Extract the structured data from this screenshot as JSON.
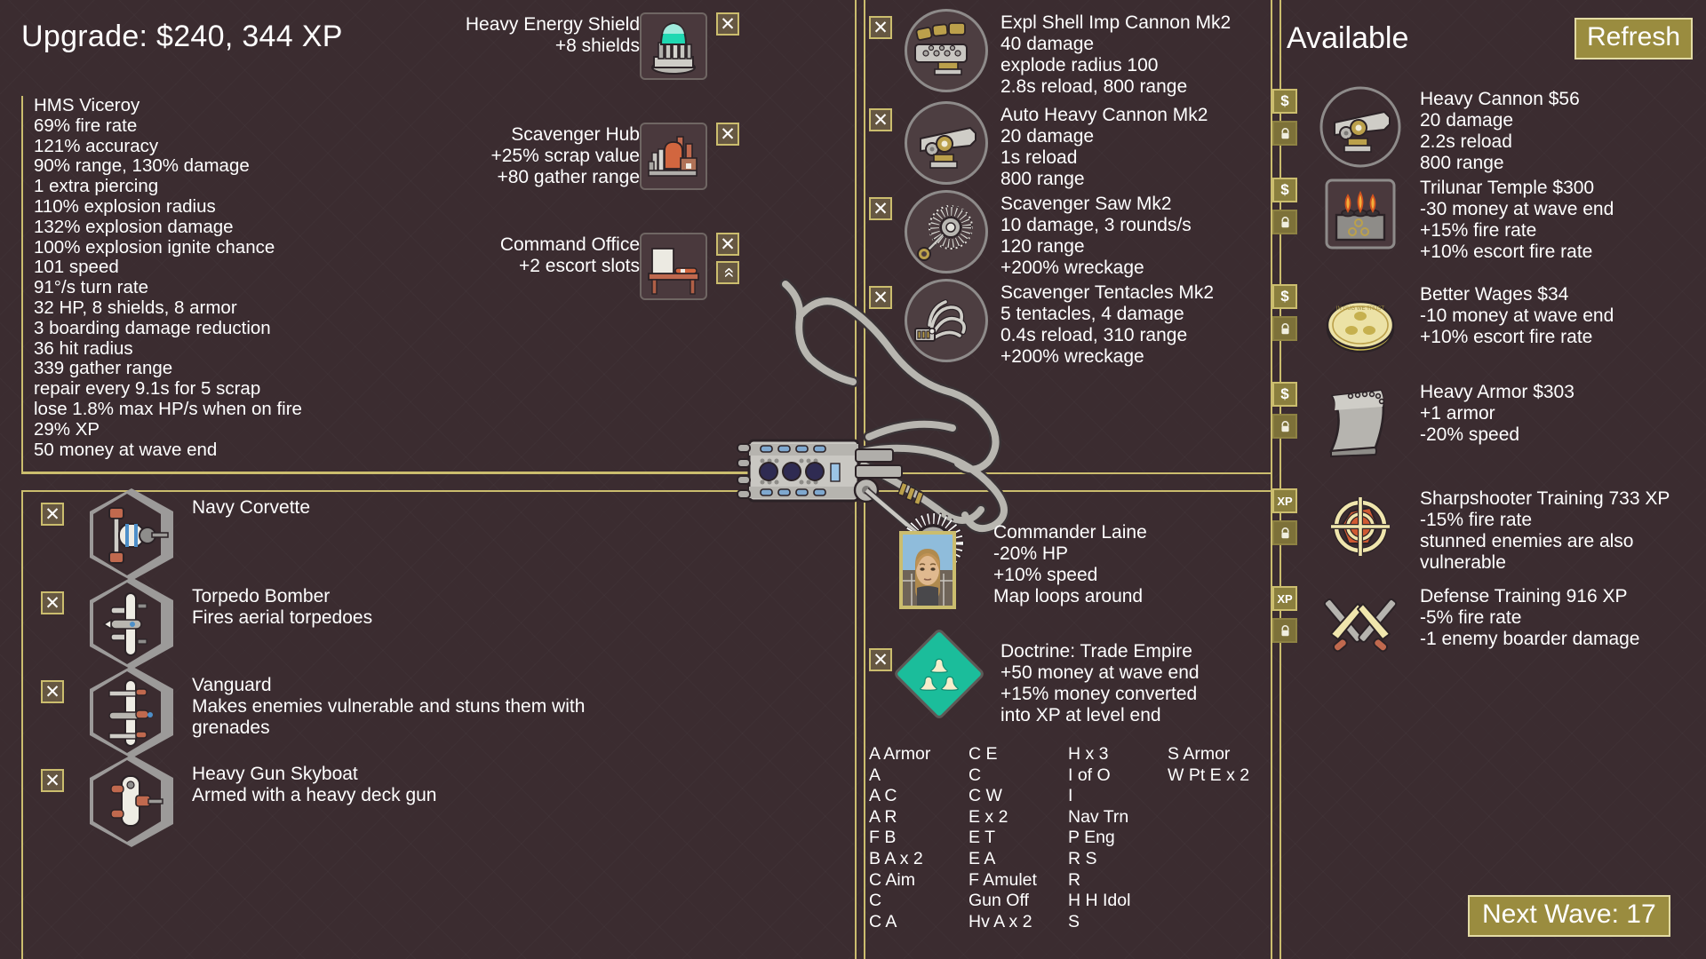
{
  "header": {
    "title": "Upgrade: $240, 344 XP"
  },
  "ship_stats": {
    "lines": [
      "HMS Viceroy",
      "69% fire rate",
      "121% accuracy",
      "90% range, 130% damage",
      "1 extra piercing",
      "110% explosion radius",
      "132% explosion damage",
      "100% explosion ignite chance",
      "101 speed",
      "91°/s turn rate",
      "32 HP, 8 shields, 8 armor",
      "3 boarding damage reduction",
      "36 hit radius",
      "339 gather range",
      "repair every 9.1s for 5 scrap",
      "lose 1.8% max HP/s when on fire",
      "29% XP",
      "50 money at wave end"
    ]
  },
  "escorts": [
    {
      "name": "Navy Corvette",
      "desc": "",
      "icon": "navy-corvette-icon",
      "remove_label": "✕"
    },
    {
      "name": "Torpedo Bomber",
      "desc": "Fires aerial torpedoes",
      "icon": "torpedo-bomber-icon",
      "remove_label": "✕"
    },
    {
      "name": "Vanguard",
      "desc": "Makes enemies vulnerable and stuns them with grenades",
      "icon": "vanguard-icon",
      "remove_label": "✕"
    },
    {
      "name": "Heavy Gun Skyboat",
      "desc": "Armed with a heavy deck gun",
      "icon": "heavy-gun-skyboat-icon",
      "remove_label": "✕"
    }
  ],
  "modules": [
    {
      "name": "Heavy Energy Shield",
      "effects": [
        "+8 shields"
      ],
      "icon": "energy-shield-icon",
      "remove_label": "✕",
      "has_upgrade": false
    },
    {
      "name": "Scavenger Hub",
      "effects": [
        "+25% scrap value",
        "+80 gather range"
      ],
      "icon": "scavenger-hub-icon",
      "remove_label": "✕",
      "has_upgrade": false
    },
    {
      "name": "Command Office",
      "effects": [
        "+2 escort slots"
      ],
      "icon": "command-office-icon",
      "remove_label": "✕",
      "upgrade_label": "»",
      "has_upgrade": true
    }
  ],
  "weapons": [
    {
      "name": "Expl Shell Imp Cannon Mk2",
      "stats": [
        "40 damage",
        "explode radius 100",
        "2.8s reload, 800 range"
      ],
      "icon": "explosive-shell-cannon-icon",
      "remove_label": "✕"
    },
    {
      "name": "Auto Heavy Cannon Mk2",
      "stats": [
        "20 damage",
        "1s reload",
        "800 range"
      ],
      "icon": "auto-heavy-cannon-icon",
      "remove_label": "✕"
    },
    {
      "name": "Scavenger Saw Mk2",
      "stats": [
        "10 damage, 3 rounds/s",
        "120 range",
        "+200% wreckage"
      ],
      "icon": "scavenger-saw-icon",
      "remove_label": "✕"
    },
    {
      "name": "Scavenger Tentacles Mk2",
      "stats": [
        "5 tentacles, 4 damage",
        "0.4s reload, 310 range",
        "+200% wreckage"
      ],
      "icon": "scavenger-tentacles-icon",
      "remove_label": "✕"
    }
  ],
  "commander": {
    "name": "Commander Laine",
    "effects": [
      "-20% HP",
      "+10% speed",
      "Map loops around"
    ],
    "portrait": "commander-portrait"
  },
  "doctrine": {
    "name": "Doctrine: Trade Empire",
    "effects": [
      "+50 money at wave end",
      "+15% money converted",
      "into XP at level end"
    ],
    "icon": "trade-empire-icon",
    "remove_label": "✕"
  },
  "abbreviations": {
    "columns": [
      [
        "A Armor",
        "A",
        "A C",
        "A R",
        "F B",
        "B A x 2",
        "C Aim",
        "C",
        "C A"
      ],
      [
        "C E",
        "C",
        "C W",
        "E x 2",
        "E T",
        "E A",
        "F Amulet",
        "Gun Off",
        "Hv A x 2"
      ],
      [
        "H x 3",
        "I of O",
        "I",
        "Nav Trn",
        "P Eng",
        "R S",
        "R",
        "H H Idol",
        "S"
      ],
      [
        "S Armor",
        "W Pt E x 2"
      ]
    ]
  },
  "available": {
    "title": "Available",
    "refresh_label": "Refresh",
    "money_badge": "$",
    "xp_badge": "XP",
    "lock_badge": "🔒",
    "items": [
      {
        "name": "Heavy Cannon $56",
        "effects": [
          "20 damage",
          "2.2s reload",
          "800 range"
        ],
        "icon": "heavy-cannon-icon",
        "cost_type": "$"
      },
      {
        "name": "Trilunar Temple $300",
        "effects": [
          "-30 money at wave end",
          "+15% fire rate",
          "+10% escort fire rate"
        ],
        "icon": "trilunar-temple-icon",
        "cost_type": "$"
      },
      {
        "name": "Better Wages $34",
        "effects": [
          "-10 money at wave end",
          "+10% escort fire rate"
        ],
        "icon": "better-wages-coin-icon",
        "cost_type": "$"
      },
      {
        "name": "Heavy Armor $303",
        "effects": [
          "+1 armor",
          "-20% speed"
        ],
        "icon": "heavy-armor-icon",
        "cost_type": "$"
      },
      {
        "name": "Sharpshooter Training 733 XP",
        "effects": [
          "-15% fire rate",
          "stunned enemies are also",
          "vulnerable"
        ],
        "icon": "sharpshooter-target-icon",
        "cost_type": "XP"
      },
      {
        "name": "Defense Training 916 XP",
        "effects": [
          "-5% fire rate",
          "-1 enemy boarder damage"
        ],
        "icon": "defense-swords-icon",
        "cost_type": "XP"
      }
    ]
  },
  "footer": {
    "next_wave_label": "Next Wave: 17"
  },
  "colors": {
    "background": "#3b2c30",
    "gold": "#cbbd6e",
    "button": "#9a8c3f",
    "teal": "#1bbd9b",
    "text": "#ffffff"
  }
}
